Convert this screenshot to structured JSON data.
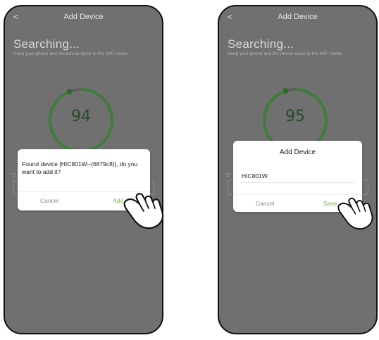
{
  "screens": [
    {
      "header_title": "Add Device",
      "back_glyph": "<",
      "heading": "Searching...",
      "subtitle": "Keep your phone and the device close to the WiFi router",
      "progress": 94,
      "bg_label": "D",
      "dialog": {
        "message": "Found device [HIC801W--(6879c8)], do you want to add it?",
        "cancel_label": "Cancel",
        "confirm_label": "Add"
      }
    },
    {
      "header_title": "Add Device",
      "back_glyph": "<",
      "heading": "Searching...",
      "subtitle": "Keep your phone and the device close to the WiFi router",
      "progress": 95,
      "bg_label": "D",
      "dialog": {
        "title": "Add Device",
        "field_value": "HIC801W",
        "cancel_label": "Cancel",
        "confirm_label": "Save"
      }
    }
  ],
  "colors": {
    "overlay": "#707070",
    "ring_track": "#5e5e5e",
    "ring_progress": "#3f7d3a",
    "accent": "#7fb447"
  },
  "icons": [
    "chevron-left-icon",
    "tap-hand-icon"
  ]
}
